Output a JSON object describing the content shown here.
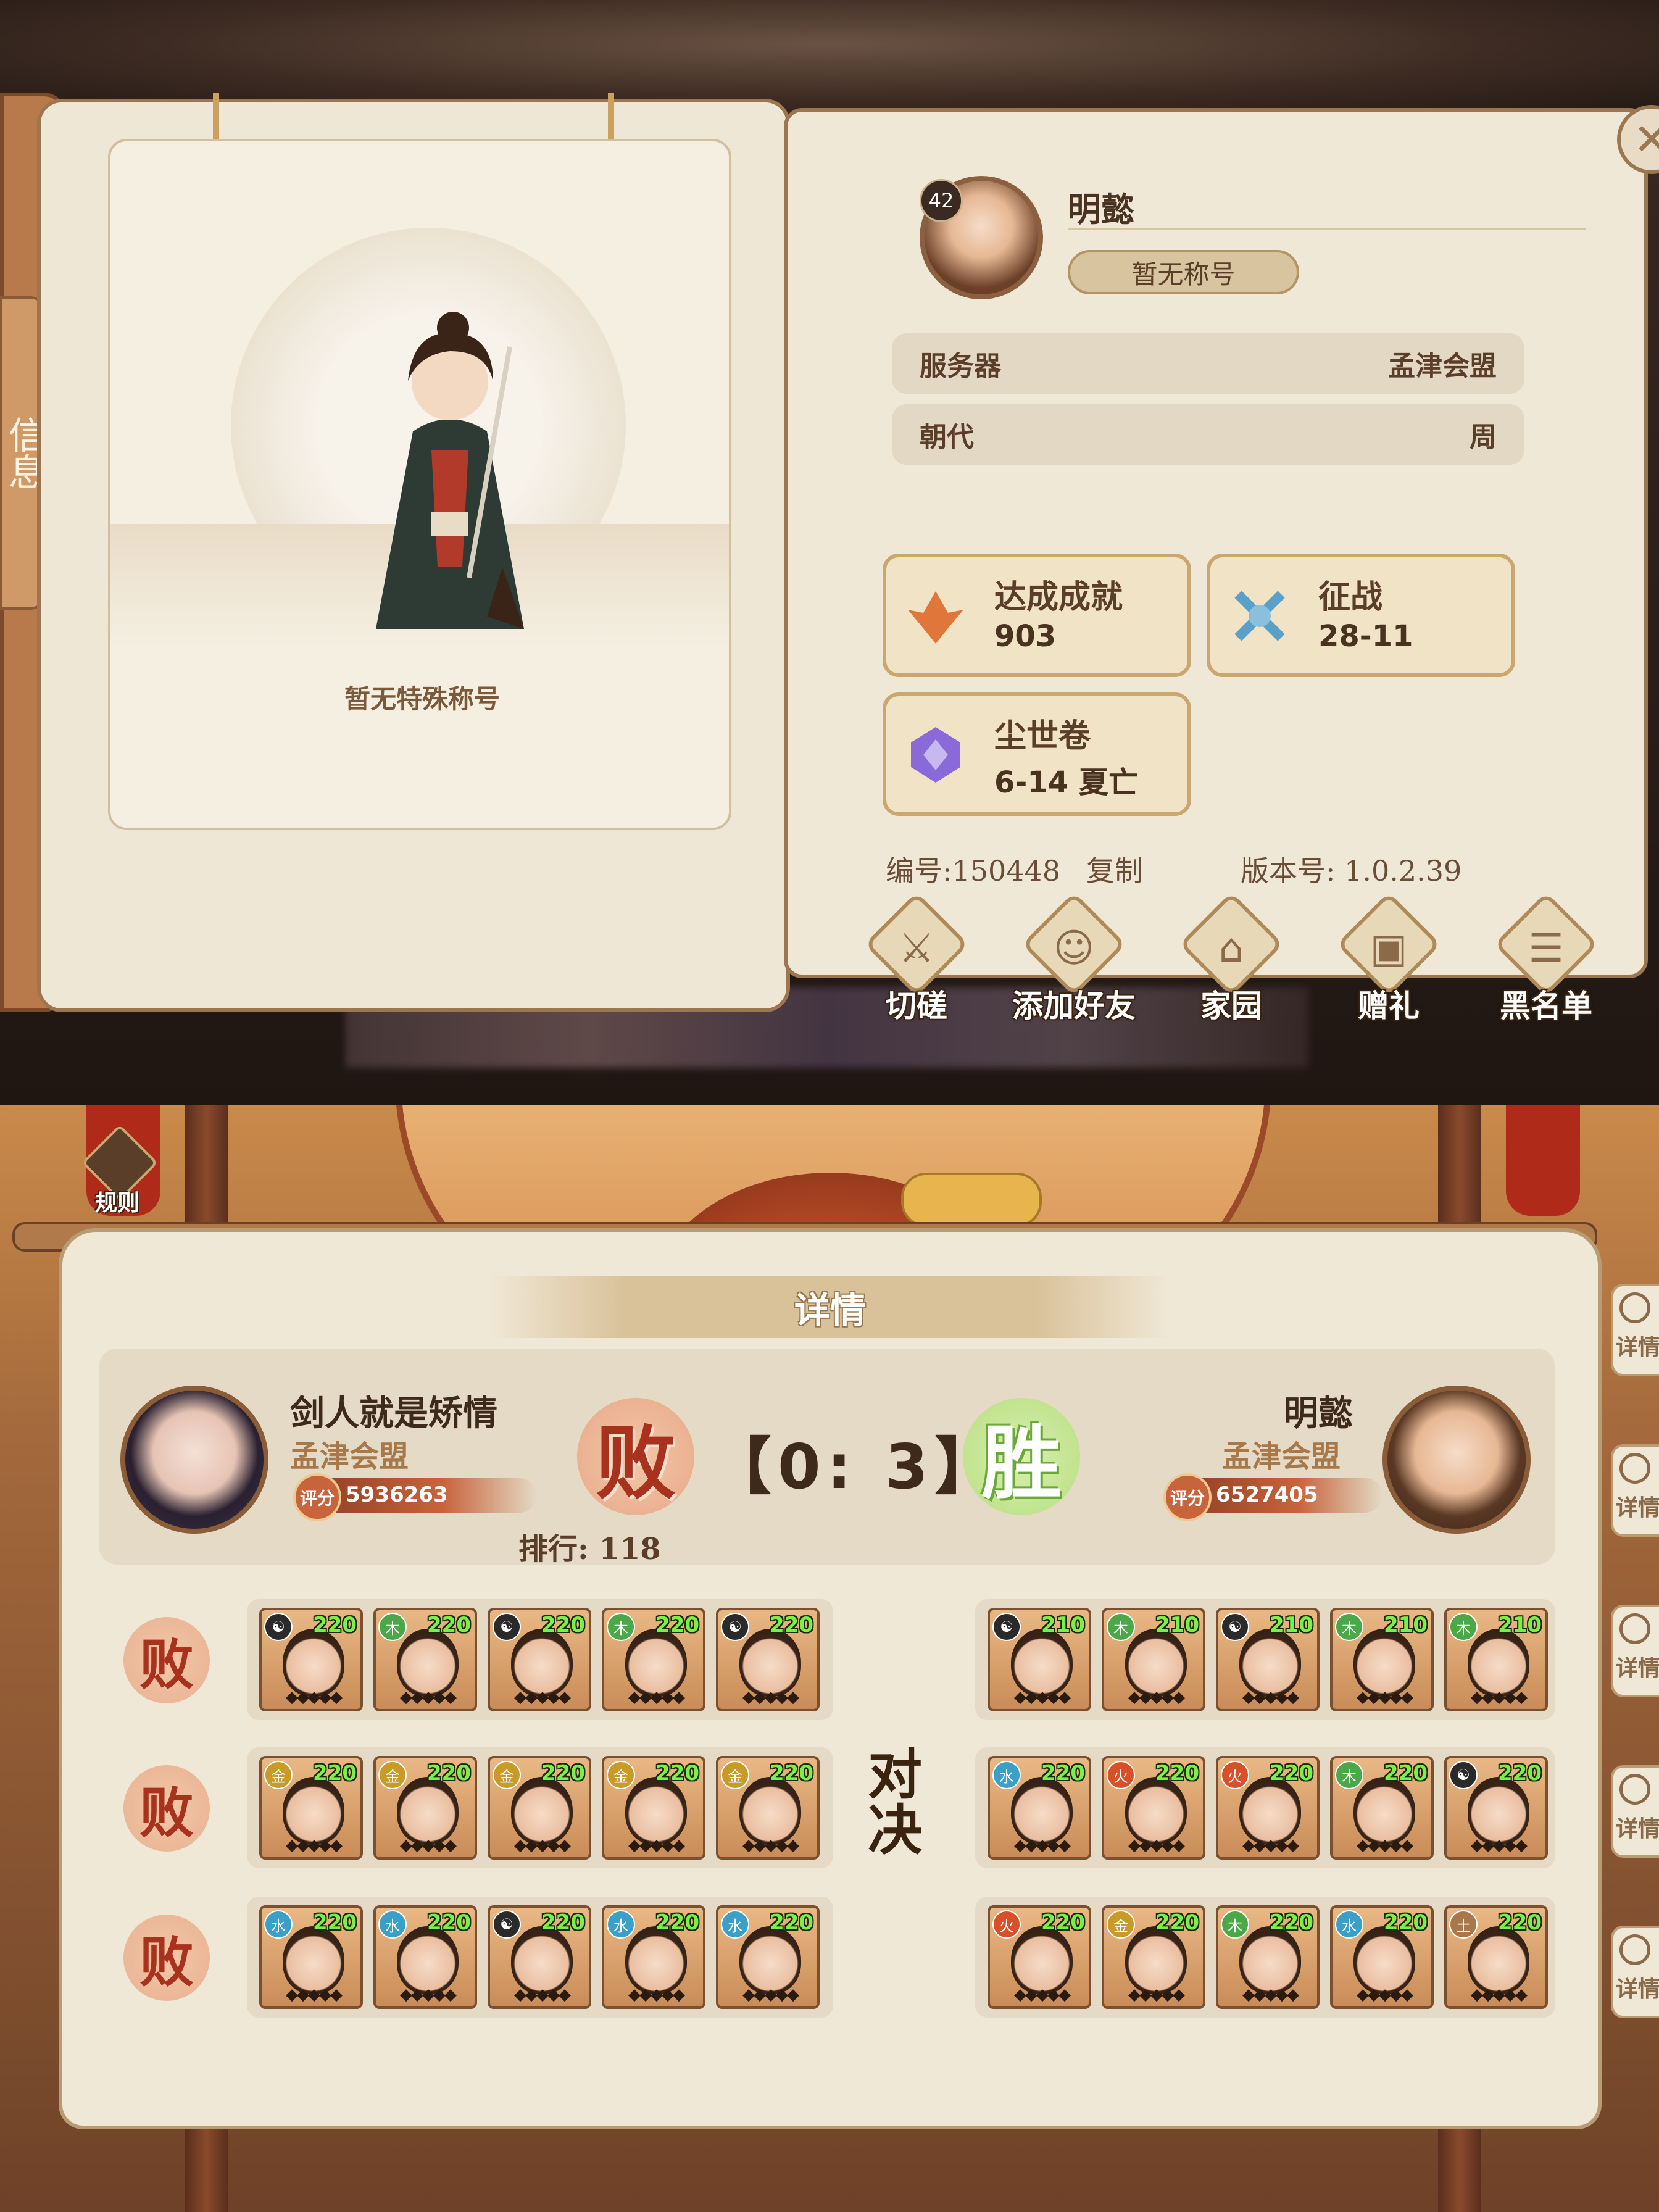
{
  "profile": {
    "level": "42",
    "name": "明懿",
    "title_pill": "暂无称号",
    "special_title": "暂无特殊称号",
    "left_tab_label": "信息",
    "server_label": "服务器",
    "server_value": "孟津会盟",
    "dynasty_label": "朝代",
    "dynasty_value": "周",
    "stats": [
      {
        "label": "达成成就",
        "value": "903",
        "icon": "phoenix-icon"
      },
      {
        "label": "征战",
        "value": "28-11",
        "icon": "crossed-swords-icon"
      },
      {
        "label": "尘世卷",
        "value": "6-14 夏亡",
        "icon": "crest-icon"
      }
    ],
    "id_text": "编号:150448",
    "copy_label": "复制",
    "version_text": "版本号: 1.0.2.39",
    "actions": [
      {
        "label": "切磋",
        "icon": "scroll-swords-icon"
      },
      {
        "label": "添加好友",
        "icon": "add-friend-icon"
      },
      {
        "label": "家园",
        "icon": "home-icon"
      },
      {
        "label": "赠礼",
        "icon": "gift-icon"
      },
      {
        "label": "黑名单",
        "icon": "blacklist-icon"
      }
    ]
  },
  "battle": {
    "rule_label": "规则",
    "title": "详情",
    "left_player": {
      "name": "剑人就是矫情",
      "server": "孟津会盟",
      "score_chip": "评分",
      "score": "5936263",
      "result": "败"
    },
    "right_player": {
      "name": "明懿",
      "server": "孟津会盟",
      "score_chip": "评分",
      "score": "6527405",
      "result": "胜"
    },
    "score_text": "【0: 3】",
    "rank_text": "排行: 118",
    "duel_text": "对决",
    "side_tab_label": "详情",
    "rows": [
      {
        "result": "败",
        "left": [
          {
            "elem": "☯",
            "level": "220"
          },
          {
            "elem": "木",
            "level": "220"
          },
          {
            "elem": "☯",
            "level": "220"
          },
          {
            "elem": "木",
            "level": "220"
          },
          {
            "elem": "☯",
            "level": "220"
          }
        ],
        "right": [
          {
            "elem": "☯",
            "level": "210"
          },
          {
            "elem": "木",
            "level": "210"
          },
          {
            "elem": "☯",
            "level": "210"
          },
          {
            "elem": "木",
            "level": "210"
          },
          {
            "elem": "木",
            "level": "210"
          }
        ]
      },
      {
        "result": "败",
        "left": [
          {
            "elem": "金",
            "level": "220"
          },
          {
            "elem": "金",
            "level": "220"
          },
          {
            "elem": "金",
            "level": "220"
          },
          {
            "elem": "金",
            "level": "220"
          },
          {
            "elem": "金",
            "level": "220"
          }
        ],
        "right": [
          {
            "elem": "水",
            "level": "220"
          },
          {
            "elem": "火",
            "level": "220"
          },
          {
            "elem": "火",
            "level": "220"
          },
          {
            "elem": "木",
            "level": "220"
          },
          {
            "elem": "☯",
            "level": "220"
          }
        ]
      },
      {
        "result": "败",
        "left": [
          {
            "elem": "水",
            "level": "220"
          },
          {
            "elem": "水",
            "level": "220"
          },
          {
            "elem": "☯",
            "level": "220"
          },
          {
            "elem": "水",
            "level": "220"
          },
          {
            "elem": "水",
            "level": "220"
          }
        ],
        "right": [
          {
            "elem": "火",
            "level": "220"
          },
          {
            "elem": "金",
            "level": "220"
          },
          {
            "elem": "木",
            "level": "220"
          },
          {
            "elem": "水",
            "level": "220"
          },
          {
            "elem": "土",
            "level": "220"
          }
        ]
      }
    ],
    "element_colors": {
      "☯": "#2a2a2a",
      "木": "#4aa848",
      "金": "#c89a28",
      "水": "#3aa0c8",
      "火": "#d8502a",
      "土": "#a8784a"
    }
  }
}
